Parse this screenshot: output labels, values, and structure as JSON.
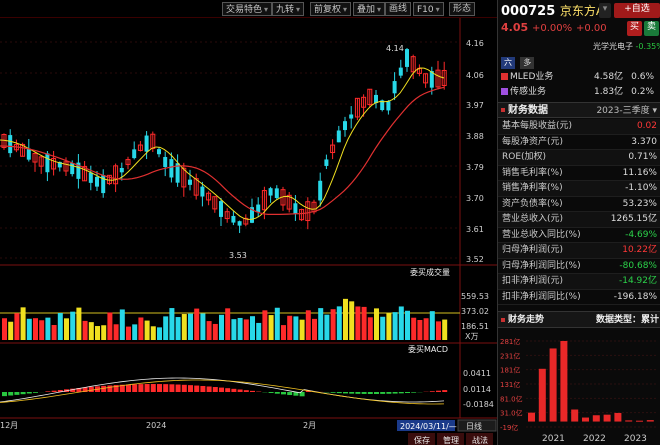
{
  "toolbar": {
    "items": [
      "交易特色",
      "九转",
      "前复权",
      "叠加",
      "画线",
      "F10",
      "形态"
    ]
  },
  "price_axis": [
    "4.16",
    "4.06",
    "3.97",
    "3.88",
    "3.79",
    "3.70",
    "3.61",
    "3.52"
  ],
  "price_annotations": {
    "high": "4.14",
    "low": "3.53"
  },
  "volume": {
    "title": "委买成交量",
    "axis": [
      "559.53",
      "373.02",
      "186.51"
    ],
    "unit": "X万"
  },
  "macd": {
    "title": "委买MACD",
    "axis": [
      "0.0411",
      "0.0114",
      "-0.0184"
    ]
  },
  "date_axis": {
    "labels": [
      "12月",
      "2024",
      "2月"
    ],
    "cursor_date": "2024/03/11/—",
    "period_label": "日线"
  },
  "bottom_buttons": [
    "保存",
    "管理",
    "战法"
  ],
  "stock": {
    "code": "000725",
    "name": "京东方A",
    "price": "4.05",
    "change_pct": "+0.00%",
    "change": "+0.00",
    "self_select": "自选",
    "buy": "买",
    "sell": "卖",
    "concept_name": "光学光电子",
    "concept_pct": "-0.35%",
    "tab_six": "六",
    "tab_duo": "多"
  },
  "business": [
    {
      "name": "MLED业务",
      "value": "4.58亿",
      "pct": "0.6%",
      "color": "#e03030"
    },
    {
      "name": "传感业务",
      "value": "1.83亿",
      "pct": "0.2%",
      "color": "#a050e0"
    }
  ],
  "financial": {
    "title": "财务数据",
    "period": "2023-三季度",
    "rows": [
      {
        "label": "基本每股收益(元)",
        "value": "0.02",
        "color": "red"
      },
      {
        "label": "每股净资产(元)",
        "value": "3.370",
        "color": "normal"
      },
      {
        "label": "ROE(加权)",
        "value": "0.71%",
        "color": "normal"
      },
      {
        "label": "销售毛利率(%)",
        "value": "11.16%",
        "color": "normal"
      },
      {
        "label": "销售净利率(%)",
        "value": "-1.10%",
        "color": "normal"
      },
      {
        "label": "资产负债率(%)",
        "value": "53.23%",
        "color": "normal"
      },
      {
        "label": "营业总收入(元)",
        "value": "1265.15亿",
        "color": "normal"
      },
      {
        "label": "营业总收入同比(%)",
        "value": "-4.69%",
        "color": "green"
      },
      {
        "label": "归母净利润(元)",
        "value": "10.22亿",
        "color": "red"
      },
      {
        "label": "归母净利润同比(%)",
        "value": "-80.68%",
        "color": "green"
      },
      {
        "label": "扣非净利润(元)",
        "value": "-14.92亿",
        "color": "green"
      },
      {
        "label": "扣非净利润同比(%)",
        "value": "-196.18%",
        "color": "normal"
      }
    ]
  },
  "trend": {
    "title": "财务走势",
    "data_type": "数据类型：累计",
    "chart_data": {
      "type": "bar",
      "y_ticks": [
        "281亿",
        "231亿",
        "181亿",
        "131亿",
        "81.0亿",
        "31.0亿",
        "-19亿"
      ],
      "x_labels": [
        "2021",
        "2022",
        "2023"
      ],
      "values": [
        31,
        184,
        255,
        281,
        42,
        14,
        22,
        24,
        30,
        4,
        3,
        5
      ]
    }
  }
}
